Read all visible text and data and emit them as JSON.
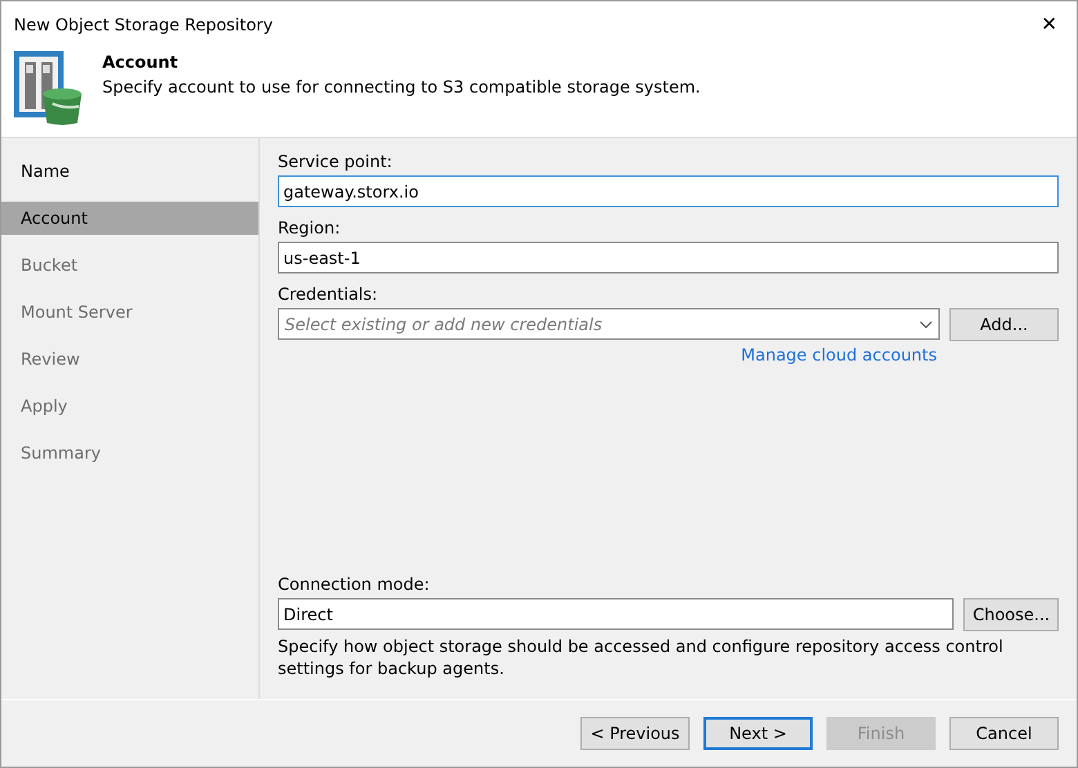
{
  "window": {
    "title": "New Object Storage Repository",
    "close": "✕"
  },
  "header": {
    "title": "Account",
    "subtitle": "Specify account to use for connecting to S3 compatible storage system."
  },
  "steps": [
    {
      "label": "Name",
      "selected": false,
      "disabled": false
    },
    {
      "label": "Account",
      "selected": true,
      "disabled": false
    },
    {
      "label": "Bucket",
      "selected": false,
      "disabled": true
    },
    {
      "label": "Mount Server",
      "selected": false,
      "disabled": true
    },
    {
      "label": "Review",
      "selected": false,
      "disabled": true
    },
    {
      "label": "Apply",
      "selected": false,
      "disabled": true
    },
    {
      "label": "Summary",
      "selected": false,
      "disabled": true
    }
  ],
  "service_point": {
    "label": "Service point:",
    "value": "gateway.storx.io",
    "focused": true
  },
  "region": {
    "label": "Region:",
    "value": "us-east-1",
    "focused": false
  },
  "credentials": {
    "label": "Credentials:",
    "placeholder": "Select existing or add new credentials",
    "button": "Add...",
    "link": "Manage cloud accounts"
  },
  "connection_mode": {
    "label": "Connection mode:",
    "value": "Direct",
    "button": "Choose...",
    "description": "Specify how object storage should be accessed and configure repository access control settings for backup agents."
  },
  "buttons": [
    {
      "label": "< Previous",
      "default": false,
      "disabled": false
    },
    {
      "label": "Next >",
      "default": true,
      "disabled": false
    },
    {
      "label": "Finish",
      "default": false,
      "disabled": true
    },
    {
      "label": "Cancel",
      "default": false,
      "disabled": false
    }
  ]
}
